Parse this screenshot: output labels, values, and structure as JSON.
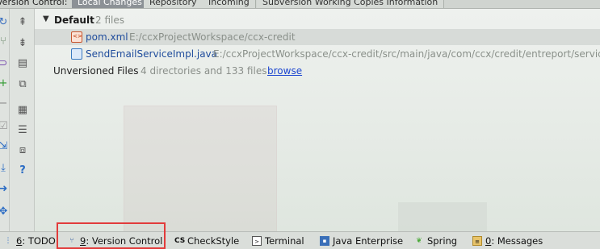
{
  "tabbar": {
    "title": "Version Control:",
    "tabs": [
      "Local Changes",
      "Repository",
      "Incoming",
      "Subversion Working Copies Information"
    ]
  },
  "changes": {
    "group": {
      "name": "Default",
      "count": "2 files"
    },
    "files": [
      {
        "name": "pom.xml",
        "path": "E:/ccxProjectWorkspace/ccx-credit",
        "type": "xml"
      },
      {
        "name": "SendEmailServiceImpl.java",
        "path": "E:/ccxProjectWorkspace/ccx-credit/src/main/java/com/ccx/credit/entreport/service",
        "type": "java"
      }
    ],
    "unversioned": {
      "label": "Unversioned Files",
      "count": "4 directories and 133 files",
      "link": "browse"
    }
  },
  "statusbar": {
    "items": [
      {
        "key": "6",
        "label": ": TODO",
        "icon": "todo-icon"
      },
      {
        "key": "9",
        "label": ": Version Control",
        "icon": "version-control-icon"
      },
      {
        "key": "",
        "label": "CheckStyle",
        "icon": "checkstyle-icon",
        "icon_text": "CS"
      },
      {
        "key": "",
        "label": "Terminal",
        "icon": "terminal-icon"
      },
      {
        "key": "",
        "label": "Java Enterprise",
        "icon": "java-enterprise-icon"
      },
      {
        "key": "",
        "label": "Spring",
        "icon": "spring-icon"
      },
      {
        "key": "0",
        "label": ": Messages",
        "icon": "messages-icon"
      }
    ]
  },
  "colors": {
    "highlight": "#e23b3b",
    "link": "#1c46d0",
    "active_tab": "#8c9196"
  }
}
